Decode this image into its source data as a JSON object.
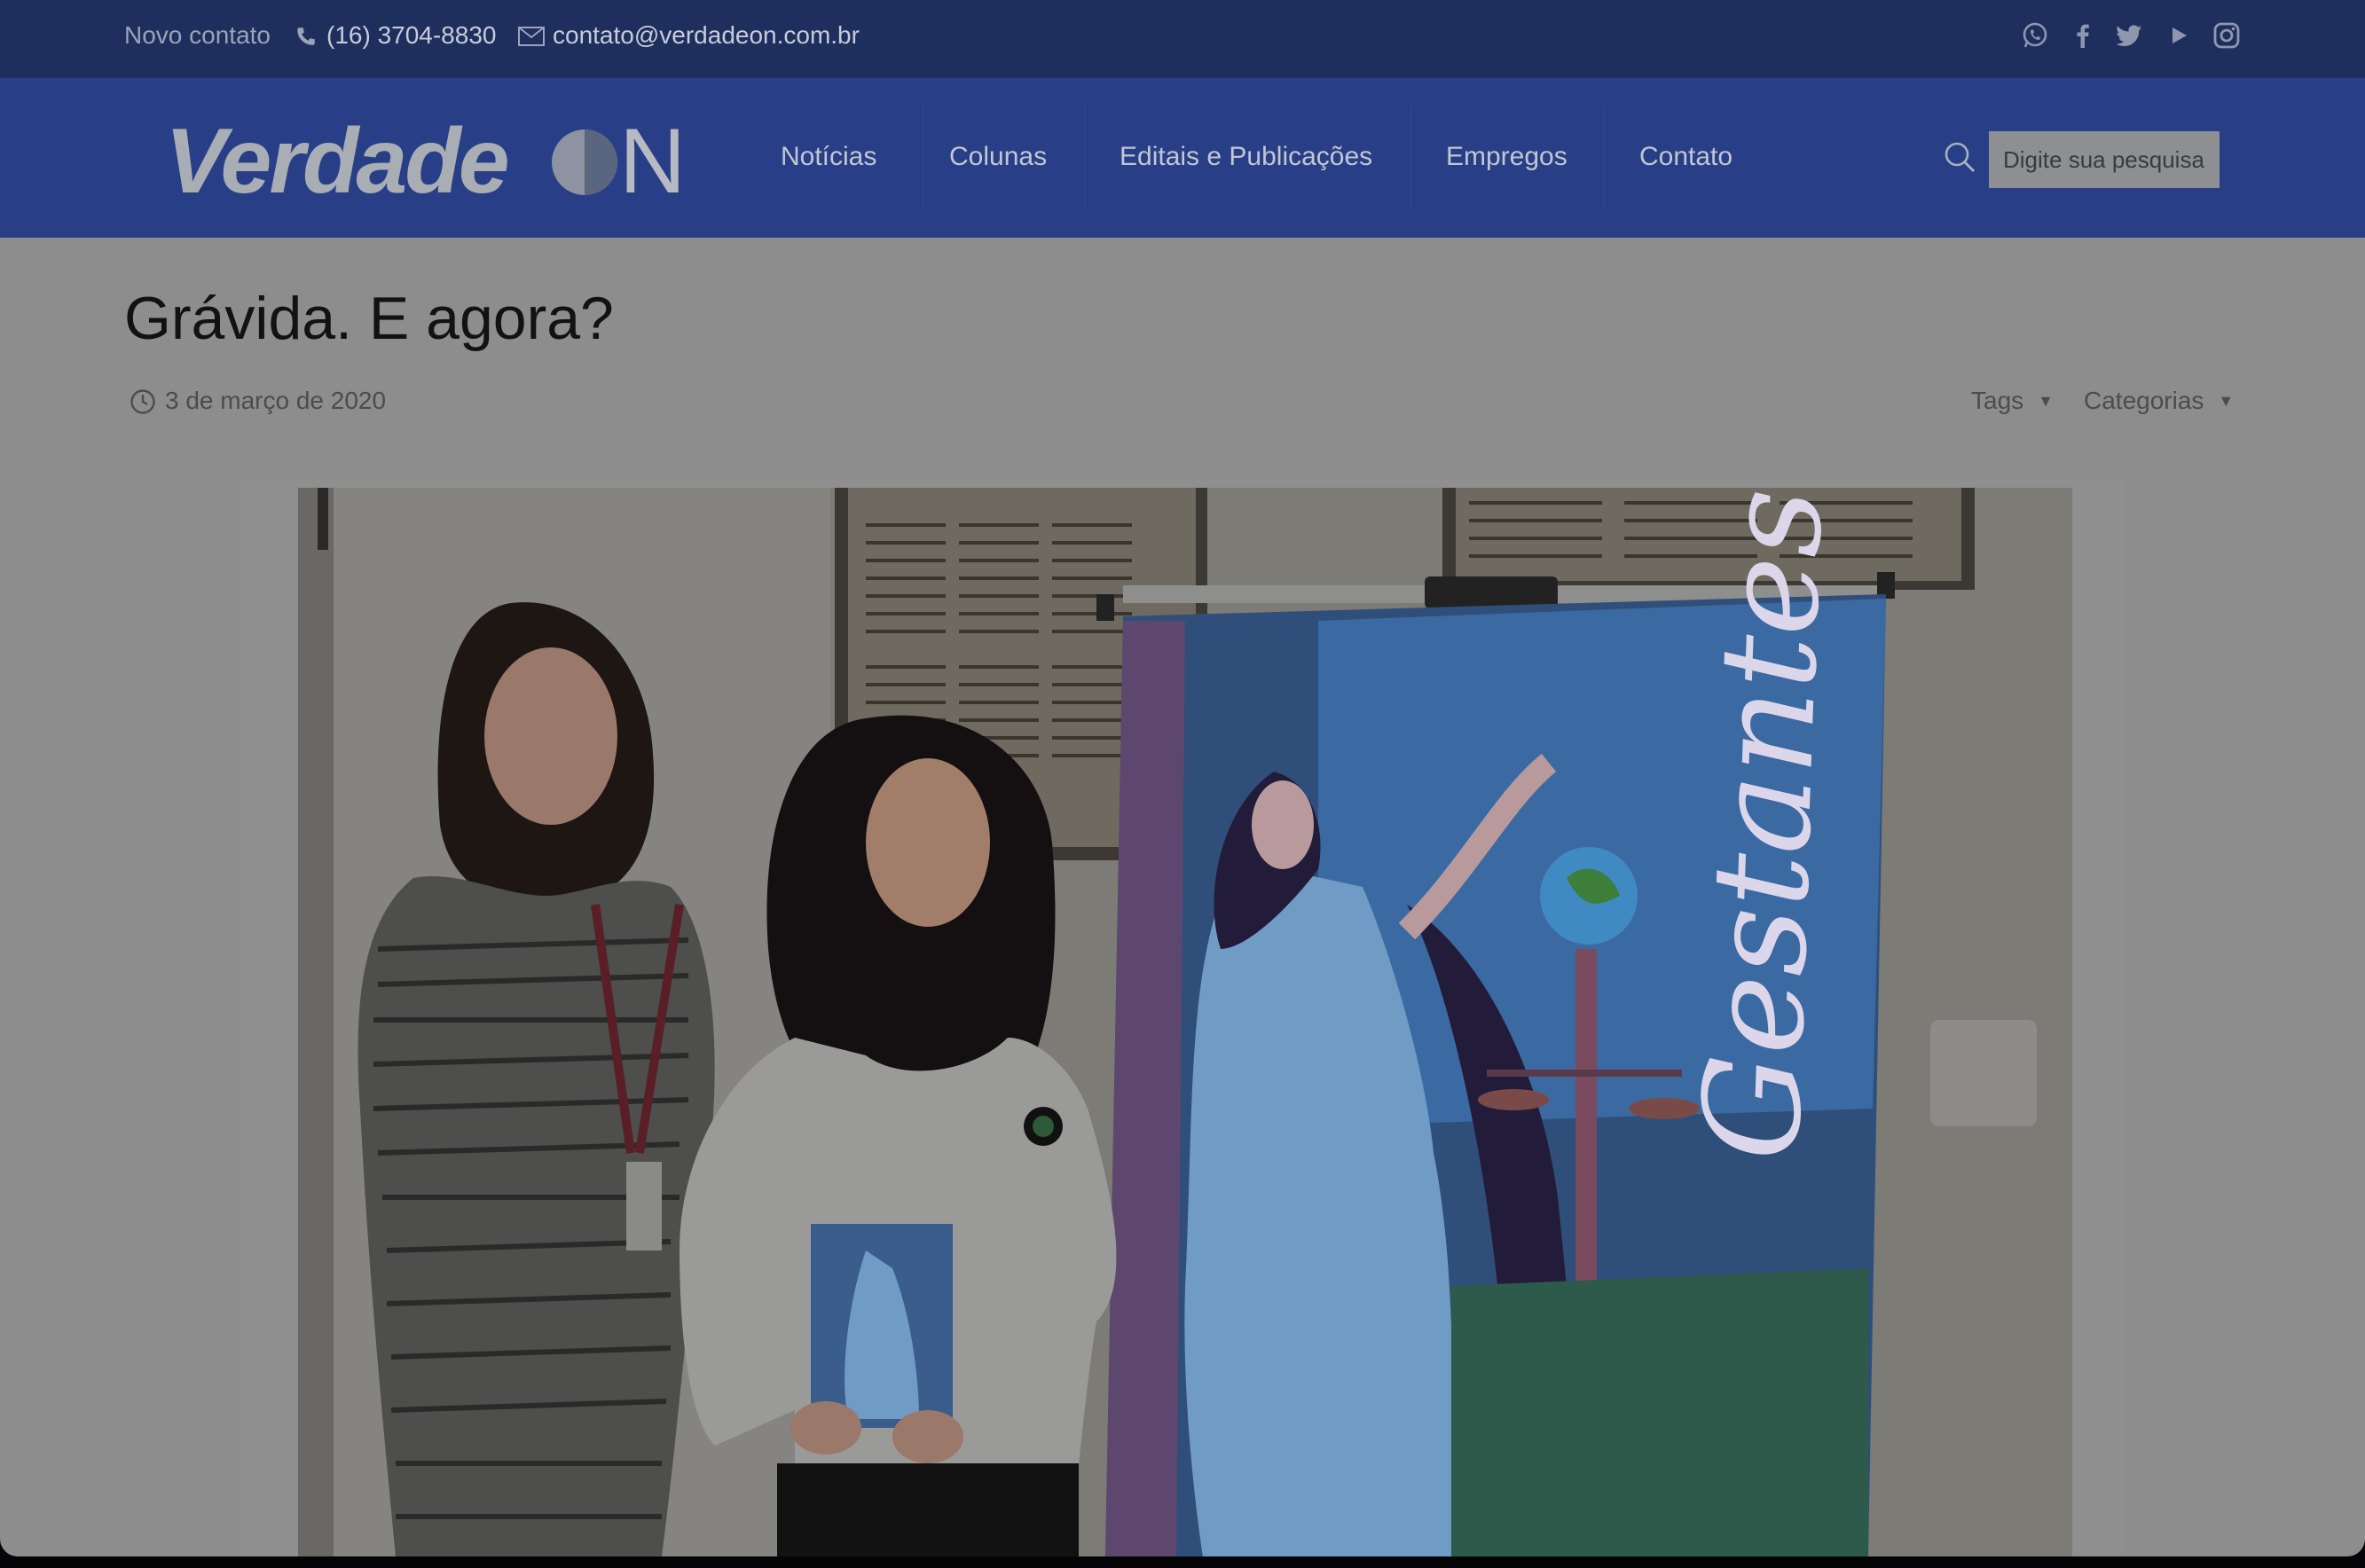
{
  "topbar": {
    "label": "Novo contato",
    "phone": "(16) 3704-8830",
    "email": "contato@verdadeon.com.br",
    "social": [
      "whatsapp-icon",
      "facebook-icon",
      "twitter-icon",
      "youtube-icon",
      "instagram-icon"
    ]
  },
  "header": {
    "logo_text": "Verdade",
    "logo_suffix": "N",
    "nav": [
      "Notícias",
      "Colunas",
      "Editais e Publicações",
      "Empregos",
      "Contato"
    ],
    "search_placeholder": "Digite sua pesquisa"
  },
  "article": {
    "title": "Grávida. E agora?",
    "date": "3 de março de 2020",
    "tags_label": "Tags",
    "categories_label": "Categorias",
    "banner_text": "Gestantes:"
  },
  "colors": {
    "topbar_bg": "#1e2f5e",
    "header_bg": "#283f87",
    "overlay_page_bg": "#8d8d8d"
  }
}
